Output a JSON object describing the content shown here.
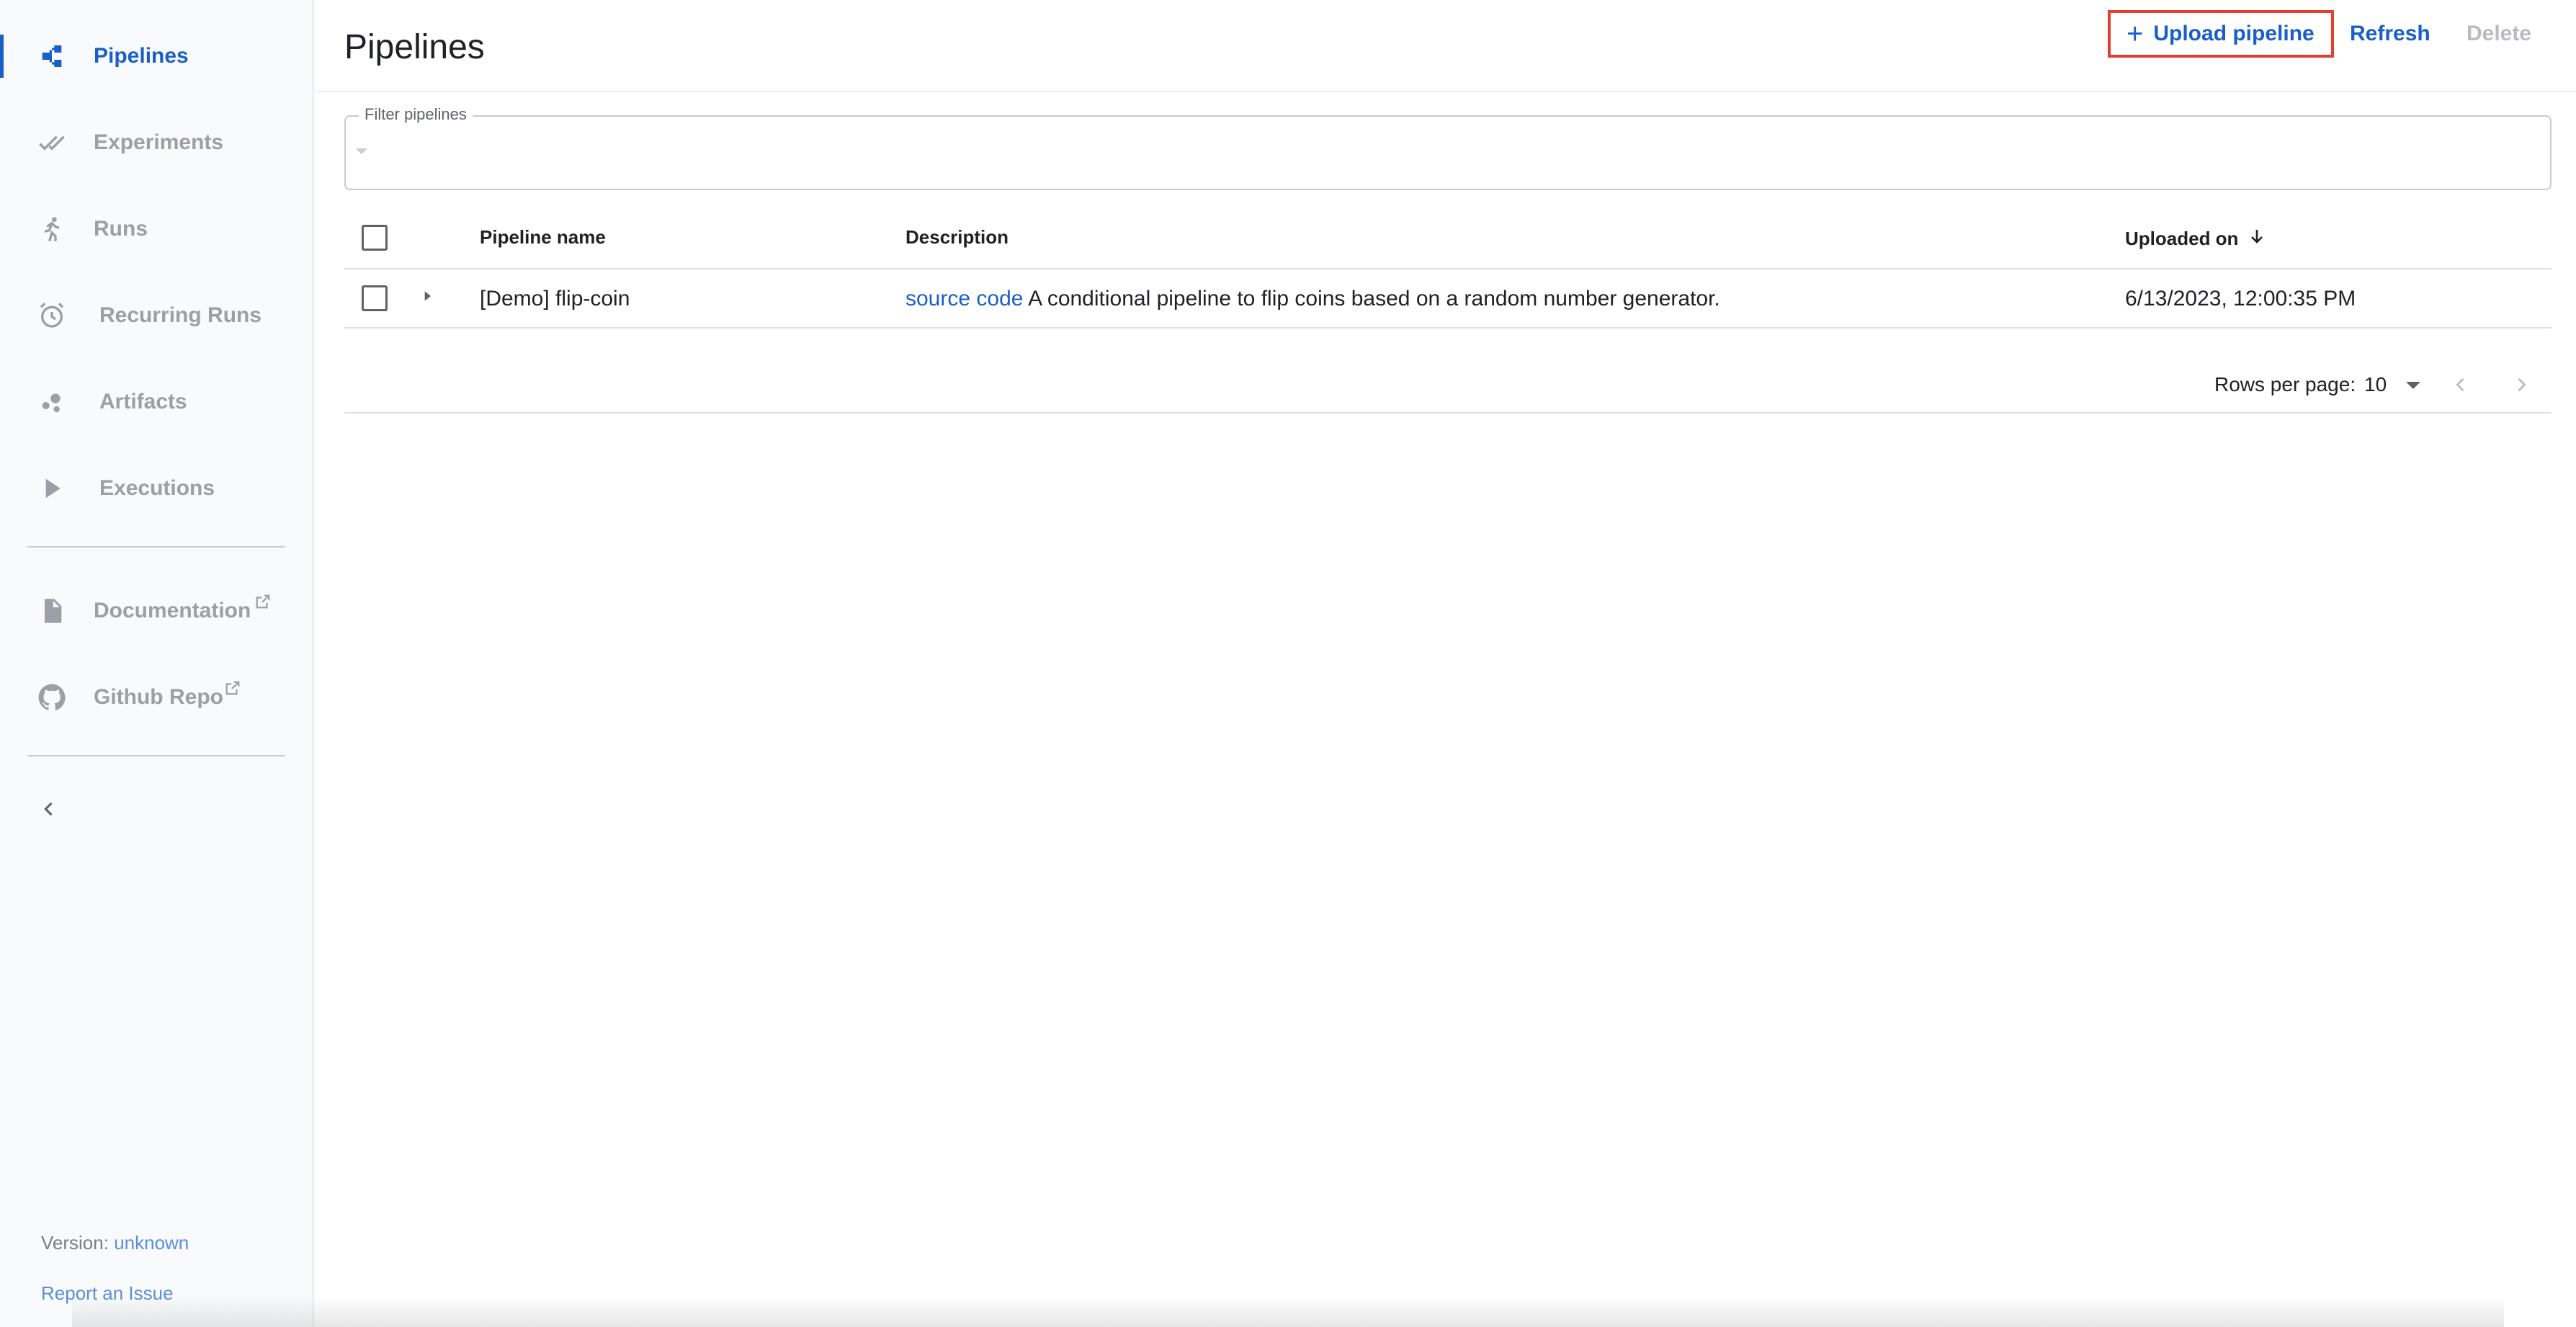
{
  "sidebar": {
    "items": [
      {
        "label": "Pipelines",
        "icon": "pipelines-icon",
        "active": true
      },
      {
        "label": "Experiments",
        "icon": "experiments-icon"
      },
      {
        "label": "Runs",
        "icon": "runs-icon"
      },
      {
        "label": "Recurring Runs",
        "icon": "alarm-clock-icon"
      },
      {
        "label": "Artifacts",
        "icon": "artifacts-icon"
      },
      {
        "label": "Executions",
        "icon": "play-icon"
      }
    ],
    "external_links": [
      {
        "label": "Documentation",
        "icon": "document-icon"
      },
      {
        "label": "Github Repo",
        "icon": "github-icon"
      }
    ],
    "version_label": "Version:",
    "version_value": "unknown",
    "report_issue": "Report an Issue"
  },
  "header": {
    "title": "Pipelines",
    "upload_label": "Upload pipeline",
    "refresh_label": "Refresh",
    "delete_label": "Delete"
  },
  "filter": {
    "label": "Filter pipelines",
    "value": ""
  },
  "table": {
    "columns": [
      "Pipeline name",
      "Description",
      "Uploaded on"
    ],
    "sort_column": "Uploaded on",
    "rows": [
      {
        "name": "[Demo] flip-coin",
        "description_link": "source code",
        "description": "A conditional pipeline to flip coins based on a random number generator.",
        "uploaded_on": "6/13/2023, 12:00:35 PM"
      }
    ]
  },
  "pagination": {
    "rows_per_page_label": "Rows per page:",
    "rows_per_page": "10"
  },
  "colors": {
    "accent": "#1a5fc8",
    "highlight": "#e0402f",
    "muted": "#9aa0a6"
  }
}
